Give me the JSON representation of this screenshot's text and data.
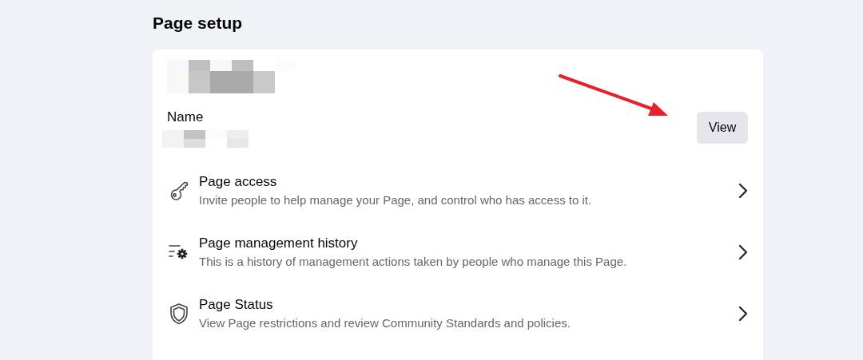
{
  "heading": "Page setup",
  "profile": {
    "name_label": "Name",
    "view_button": "View"
  },
  "items": [
    {
      "kind": "key",
      "title": "Page access",
      "description": "Invite people to help manage your Page, and control who has access to it."
    },
    {
      "kind": "history",
      "title": "Page management history",
      "description": "This is a history of management actions taken by people who manage this Page."
    },
    {
      "kind": "shield",
      "title": "Page Status",
      "description": "View Page restrictions and review Community Standards and policies."
    }
  ]
}
